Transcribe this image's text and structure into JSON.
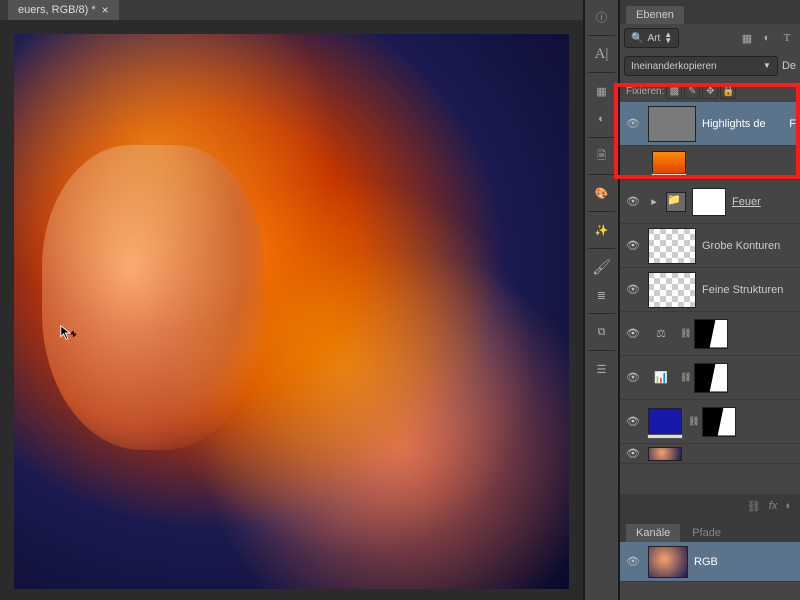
{
  "document": {
    "tab_title": "euers, RGB/8) *"
  },
  "layers_panel": {
    "tab": "Ebenen",
    "search_mode": "Art",
    "blend_mode": "Ineinanderkopieren",
    "opacity_label": "De",
    "lock_label": "Fixieren:",
    "layers": [
      {
        "name": "Highlights de",
        "extra": "F"
      },
      {
        "name": "Feuer"
      },
      {
        "name": "Grobe Konturen"
      },
      {
        "name": "Feine Strukturen"
      }
    ]
  },
  "channels_panel": {
    "tabs": {
      "a": "Kanäle",
      "b": "Pfade"
    },
    "channel": "RGB"
  },
  "footer": {
    "fx": "fx"
  }
}
